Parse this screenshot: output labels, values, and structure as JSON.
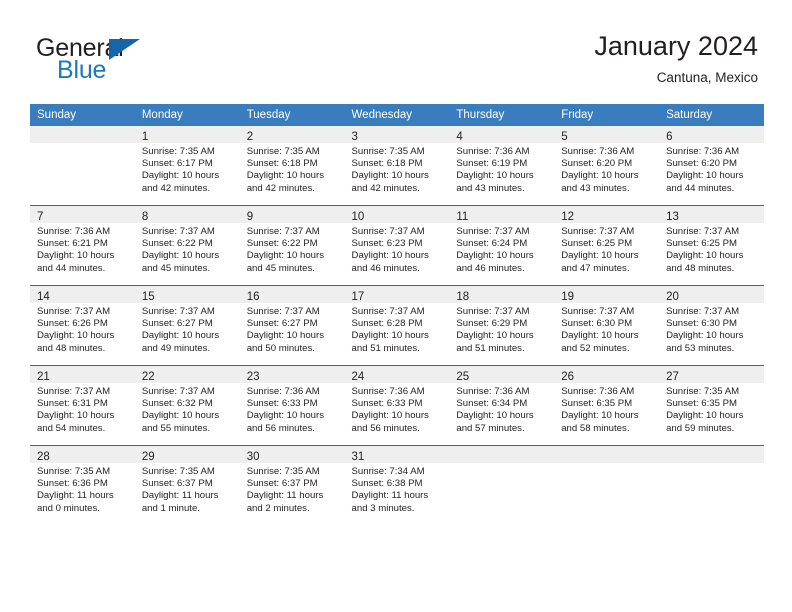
{
  "brand": {
    "name_part1": "General",
    "name_part2": "Blue",
    "flag_icon": "triangle-flag-icon"
  },
  "header": {
    "title": "January 2024",
    "subtitle": "Cantuna, Mexico"
  },
  "theme": {
    "header_blue": "#3a7dbf",
    "rule_blue": "#2a6ca8",
    "daynum_band": "#efefef",
    "brand_blue": "#1c77c3",
    "text": "#231f20"
  },
  "weekday_headers": [
    "Sunday",
    "Monday",
    "Tuesday",
    "Wednesday",
    "Thursday",
    "Friday",
    "Saturday"
  ],
  "weeks": [
    [
      {
        "day": "",
        "lines": []
      },
      {
        "day": "1",
        "lines": [
          "Sunrise: 7:35 AM",
          "Sunset: 6:17 PM",
          "Daylight: 10 hours",
          "and 42 minutes."
        ]
      },
      {
        "day": "2",
        "lines": [
          "Sunrise: 7:35 AM",
          "Sunset: 6:18 PM",
          "Daylight: 10 hours",
          "and 42 minutes."
        ]
      },
      {
        "day": "3",
        "lines": [
          "Sunrise: 7:35 AM",
          "Sunset: 6:18 PM",
          "Daylight: 10 hours",
          "and 42 minutes."
        ]
      },
      {
        "day": "4",
        "lines": [
          "Sunrise: 7:36 AM",
          "Sunset: 6:19 PM",
          "Daylight: 10 hours",
          "and 43 minutes."
        ]
      },
      {
        "day": "5",
        "lines": [
          "Sunrise: 7:36 AM",
          "Sunset: 6:20 PM",
          "Daylight: 10 hours",
          "and 43 minutes."
        ]
      },
      {
        "day": "6",
        "lines": [
          "Sunrise: 7:36 AM",
          "Sunset: 6:20 PM",
          "Daylight: 10 hours",
          "and 44 minutes."
        ]
      }
    ],
    [
      {
        "day": "7",
        "lines": [
          "Sunrise: 7:36 AM",
          "Sunset: 6:21 PM",
          "Daylight: 10 hours",
          "and 44 minutes."
        ]
      },
      {
        "day": "8",
        "lines": [
          "Sunrise: 7:37 AM",
          "Sunset: 6:22 PM",
          "Daylight: 10 hours",
          "and 45 minutes."
        ]
      },
      {
        "day": "9",
        "lines": [
          "Sunrise: 7:37 AM",
          "Sunset: 6:22 PM",
          "Daylight: 10 hours",
          "and 45 minutes."
        ]
      },
      {
        "day": "10",
        "lines": [
          "Sunrise: 7:37 AM",
          "Sunset: 6:23 PM",
          "Daylight: 10 hours",
          "and 46 minutes."
        ]
      },
      {
        "day": "11",
        "lines": [
          "Sunrise: 7:37 AM",
          "Sunset: 6:24 PM",
          "Daylight: 10 hours",
          "and 46 minutes."
        ]
      },
      {
        "day": "12",
        "lines": [
          "Sunrise: 7:37 AM",
          "Sunset: 6:25 PM",
          "Daylight: 10 hours",
          "and 47 minutes."
        ]
      },
      {
        "day": "13",
        "lines": [
          "Sunrise: 7:37 AM",
          "Sunset: 6:25 PM",
          "Daylight: 10 hours",
          "and 48 minutes."
        ]
      }
    ],
    [
      {
        "day": "14",
        "lines": [
          "Sunrise: 7:37 AM",
          "Sunset: 6:26 PM",
          "Daylight: 10 hours",
          "and 48 minutes."
        ]
      },
      {
        "day": "15",
        "lines": [
          "Sunrise: 7:37 AM",
          "Sunset: 6:27 PM",
          "Daylight: 10 hours",
          "and 49 minutes."
        ]
      },
      {
        "day": "16",
        "lines": [
          "Sunrise: 7:37 AM",
          "Sunset: 6:27 PM",
          "Daylight: 10 hours",
          "and 50 minutes."
        ]
      },
      {
        "day": "17",
        "lines": [
          "Sunrise: 7:37 AM",
          "Sunset: 6:28 PM",
          "Daylight: 10 hours",
          "and 51 minutes."
        ]
      },
      {
        "day": "18",
        "lines": [
          "Sunrise: 7:37 AM",
          "Sunset: 6:29 PM",
          "Daylight: 10 hours",
          "and 51 minutes."
        ]
      },
      {
        "day": "19",
        "lines": [
          "Sunrise: 7:37 AM",
          "Sunset: 6:30 PM",
          "Daylight: 10 hours",
          "and 52 minutes."
        ]
      },
      {
        "day": "20",
        "lines": [
          "Sunrise: 7:37 AM",
          "Sunset: 6:30 PM",
          "Daylight: 10 hours",
          "and 53 minutes."
        ]
      }
    ],
    [
      {
        "day": "21",
        "lines": [
          "Sunrise: 7:37 AM",
          "Sunset: 6:31 PM",
          "Daylight: 10 hours",
          "and 54 minutes."
        ]
      },
      {
        "day": "22",
        "lines": [
          "Sunrise: 7:37 AM",
          "Sunset: 6:32 PM",
          "Daylight: 10 hours",
          "and 55 minutes."
        ]
      },
      {
        "day": "23",
        "lines": [
          "Sunrise: 7:36 AM",
          "Sunset: 6:33 PM",
          "Daylight: 10 hours",
          "and 56 minutes."
        ]
      },
      {
        "day": "24",
        "lines": [
          "Sunrise: 7:36 AM",
          "Sunset: 6:33 PM",
          "Daylight: 10 hours",
          "and 56 minutes."
        ]
      },
      {
        "day": "25",
        "lines": [
          "Sunrise: 7:36 AM",
          "Sunset: 6:34 PM",
          "Daylight: 10 hours",
          "and 57 minutes."
        ]
      },
      {
        "day": "26",
        "lines": [
          "Sunrise: 7:36 AM",
          "Sunset: 6:35 PM",
          "Daylight: 10 hours",
          "and 58 minutes."
        ]
      },
      {
        "day": "27",
        "lines": [
          "Sunrise: 7:35 AM",
          "Sunset: 6:35 PM",
          "Daylight: 10 hours",
          "and 59 minutes."
        ]
      }
    ],
    [
      {
        "day": "28",
        "lines": [
          "Sunrise: 7:35 AM",
          "Sunset: 6:36 PM",
          "Daylight: 11 hours",
          "and 0 minutes."
        ]
      },
      {
        "day": "29",
        "lines": [
          "Sunrise: 7:35 AM",
          "Sunset: 6:37 PM",
          "Daylight: 11 hours",
          "and 1 minute."
        ]
      },
      {
        "day": "30",
        "lines": [
          "Sunrise: 7:35 AM",
          "Sunset: 6:37 PM",
          "Daylight: 11 hours",
          "and 2 minutes."
        ]
      },
      {
        "day": "31",
        "lines": [
          "Sunrise: 7:34 AM",
          "Sunset: 6:38 PM",
          "Daylight: 11 hours",
          "and 3 minutes."
        ]
      },
      {
        "day": "",
        "lines": []
      },
      {
        "day": "",
        "lines": []
      },
      {
        "day": "",
        "lines": []
      }
    ]
  ]
}
